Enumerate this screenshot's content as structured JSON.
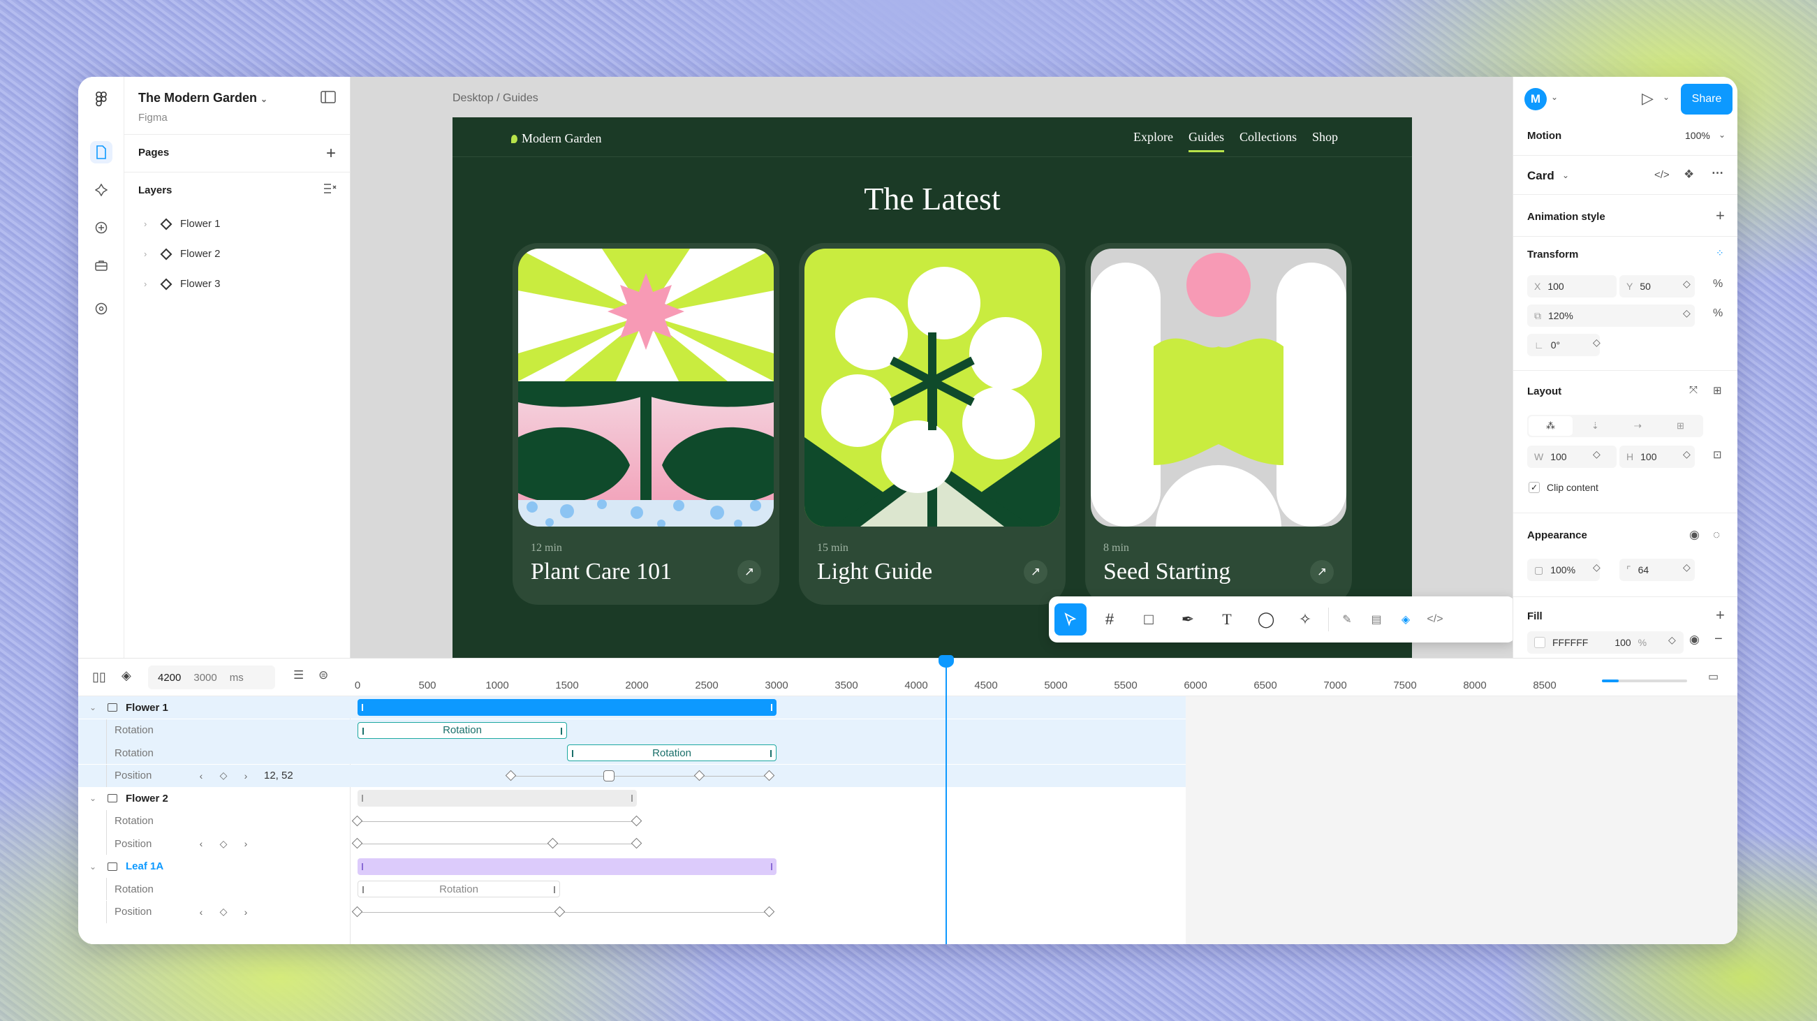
{
  "file": {
    "name": "The Modern Garden",
    "app": "Figma"
  },
  "left_panel": {
    "pages_label": "Pages",
    "layers_label": "Layers",
    "layers": [
      "Flower 1",
      "Flower 2",
      "Flower 3"
    ]
  },
  "canvas": {
    "breadcrumb": "Desktop / Guides"
  },
  "site": {
    "logo": "Modern Garden",
    "nav": [
      "Explore",
      "Guides",
      "Collections",
      "Shop"
    ],
    "active_nav": "Guides",
    "heading": "The Latest",
    "cards": [
      {
        "meta": "12 min",
        "title": "Plant Care 101"
      },
      {
        "meta": "15 min",
        "title": "Light Guide"
      },
      {
        "meta": "8 min",
        "title": "Seed Starting"
      }
    ]
  },
  "toolbar": {
    "tools": [
      "move-tool",
      "frame-tool",
      "rectangle-tool",
      "pen-tool",
      "text-tool",
      "comment-tool",
      "component-tool",
      "draw-tool",
      "layout-tool",
      "motion-tool",
      "dev-mode-tool"
    ],
    "selected": "move-tool"
  },
  "right_panel": {
    "avatar": "M",
    "share_label": "Share",
    "motion_label": "Motion",
    "zoom": "100%",
    "component_name": "Card",
    "animation_style_label": "Animation style",
    "transform_label": "Transform",
    "x_label": "X",
    "x": "100",
    "y_label": "Y",
    "y": "50",
    "scale": "120%",
    "rotation": "0°",
    "layout_label": "Layout",
    "w_label": "W",
    "w": "100",
    "h_label": "H",
    "h": "100",
    "clip_content": "Clip content",
    "appearance_label": "Appearance",
    "opacity": "100%",
    "radius": "64",
    "fill_label": "Fill",
    "fill_hex": "FFFFFF",
    "fill_opacity": "100",
    "fill_pct": "%"
  },
  "timeline": {
    "current": "4200",
    "duration": "3000",
    "unit": "ms",
    "ticks": [
      "0",
      "500",
      "1000",
      "1500",
      "2000",
      "2500",
      "3000",
      "3500",
      "4000",
      "4500",
      "5000",
      "5500",
      "6000",
      "6500",
      "7000",
      "7500",
      "8000",
      "8500"
    ],
    "rows": [
      {
        "label": "Flower 1",
        "kind": "group"
      },
      {
        "label": "Rotation",
        "kind": "prop"
      },
      {
        "label": "Rotation",
        "kind": "prop"
      },
      {
        "label": "Position",
        "kind": "prop",
        "value": "12, 52"
      },
      {
        "label": "Flower 2",
        "kind": "group"
      },
      {
        "label": "Rotation",
        "kind": "prop"
      },
      {
        "label": "Position",
        "kind": "prop"
      },
      {
        "label": "Leaf 1A",
        "kind": "group"
      },
      {
        "label": "Rotation",
        "kind": "prop"
      },
      {
        "label": "Position",
        "kind": "prop"
      }
    ],
    "bar_label": "Rotation"
  },
  "colors": {
    "accent": "#0d99ff",
    "site_bg": "#1b3a26",
    "lime": "#c9ec3f",
    "purple_bar": "#dccbfb"
  }
}
